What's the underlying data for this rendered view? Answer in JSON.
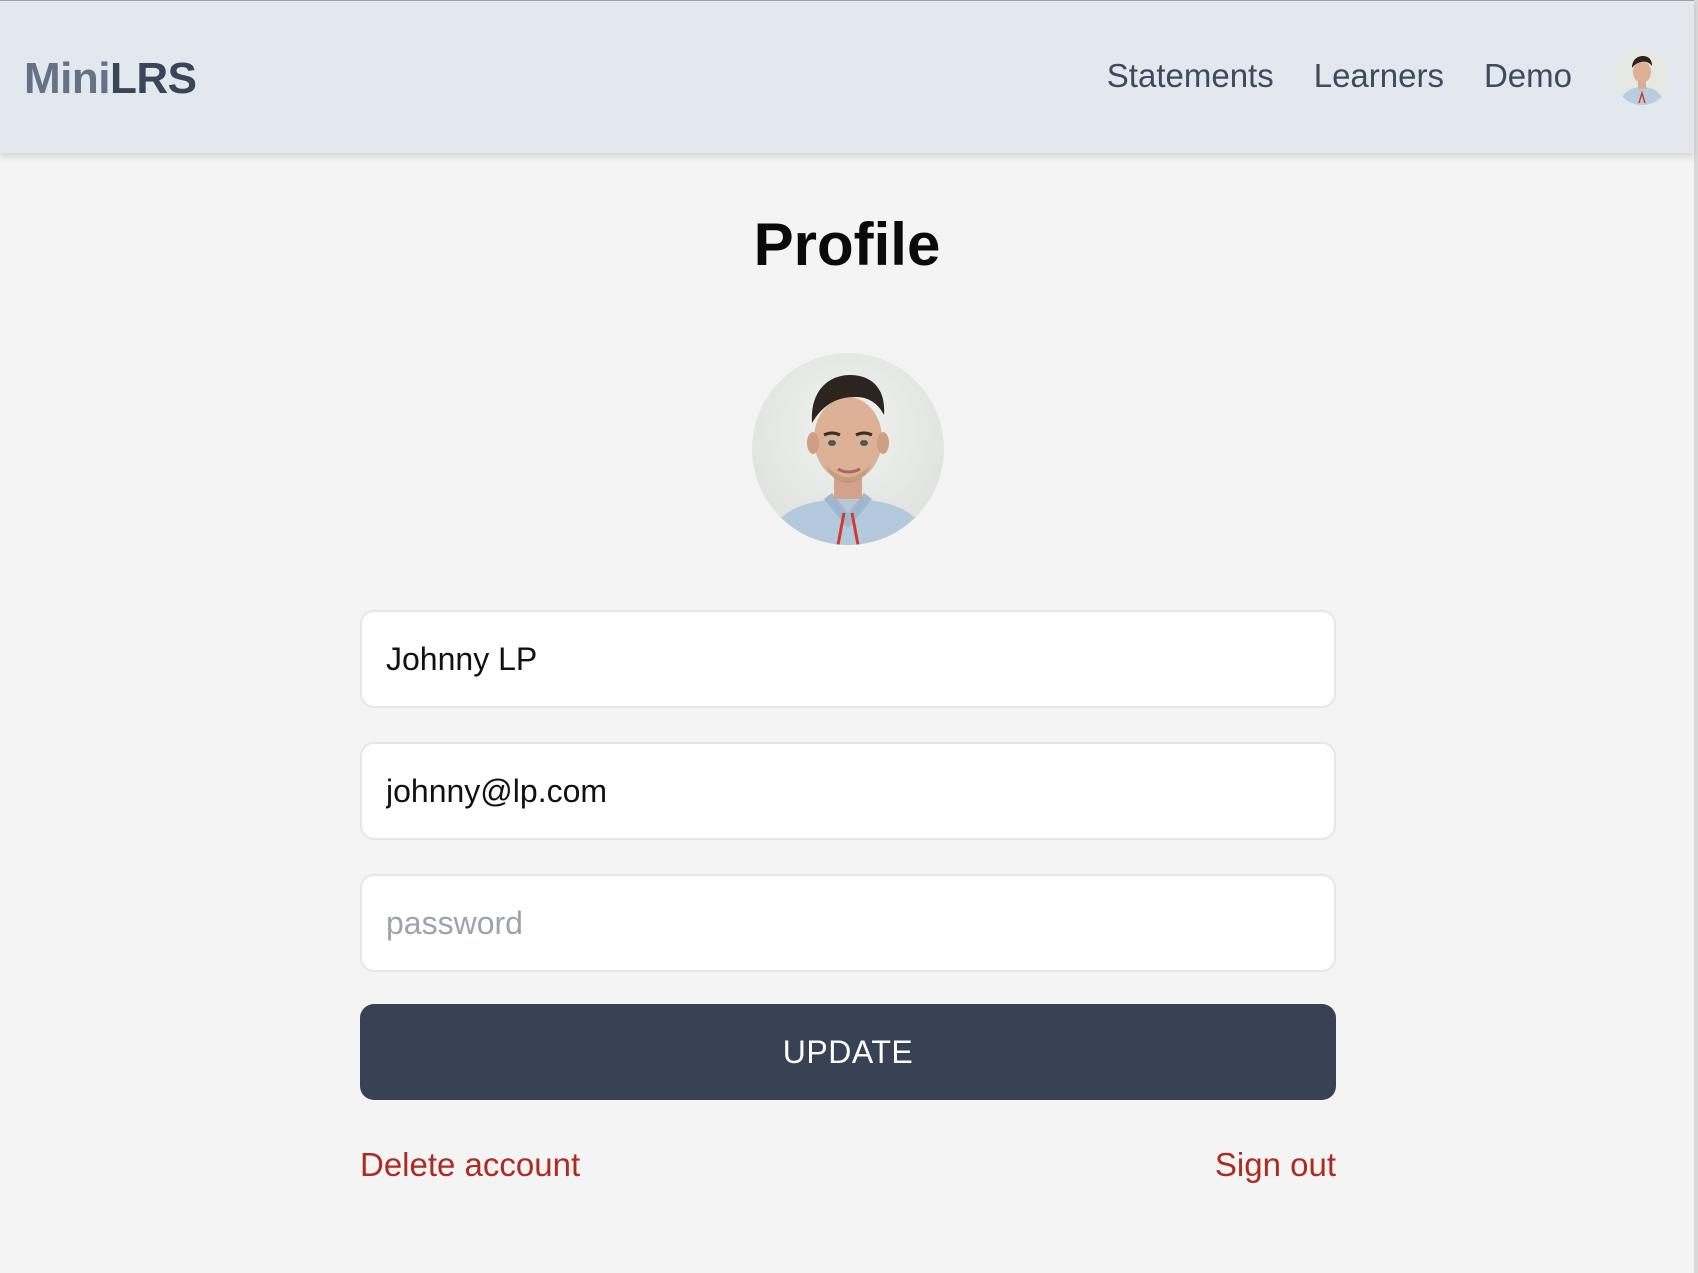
{
  "brand": {
    "mini": "Mini",
    "lrs": "LRS"
  },
  "nav": {
    "links": [
      "Statements",
      "Learners",
      "Demo"
    ],
    "avatar_icon": "user-avatar-photo"
  },
  "page": {
    "title": "Profile",
    "avatar_icon": "profile-photo"
  },
  "form": {
    "name_value": "Johnny LP",
    "email_value": "johnny@lp.com",
    "password_value": "",
    "password_placeholder": "password",
    "update_label": "UPDATE"
  },
  "actions": {
    "delete_label": "Delete account",
    "signout_label": "Sign out"
  },
  "colors": {
    "navbar_bg": "#e3e8ef",
    "page_bg": "#f4f4f4",
    "button_bg": "#384254",
    "danger": "#ad2b22"
  }
}
